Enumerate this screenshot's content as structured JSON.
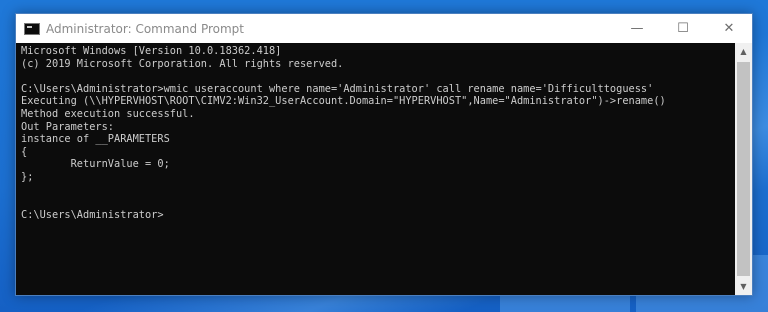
{
  "window": {
    "title": "Administrator: Command Prompt",
    "minimize_glyph": "—",
    "maximize_glyph": "☐",
    "close_glyph": "✕"
  },
  "console": {
    "lines": [
      "Microsoft Windows [Version 10.0.18362.418]",
      "(c) 2019 Microsoft Corporation. All rights reserved.",
      "",
      "C:\\Users\\Administrator>wmic useraccount where name='Administrator' call rename name='Difficulttoguess'",
      "Executing (\\\\HYPERVHOST\\ROOT\\CIMV2:Win32_UserAccount.Domain=\"HYPERVHOST\",Name=\"Administrator\")->rename()",
      "Method execution successful.",
      "Out Parameters:",
      "instance of __PARAMETERS",
      "{",
      "        ReturnValue = 0;",
      "};",
      "",
      "",
      "C:\\Users\\Administrator>"
    ]
  },
  "scrollbar": {
    "up_glyph": "▲",
    "down_glyph": "▼"
  },
  "icons": {
    "app": "cmd-icon",
    "minimize": "minimize-icon",
    "maximize": "maximize-icon",
    "close": "close-icon"
  },
  "colors": {
    "console_bg": "#0c0c0c",
    "console_fg": "#cccccc",
    "titlebar_bg": "#ffffff",
    "desktop_bg": "#1c6fd0"
  }
}
